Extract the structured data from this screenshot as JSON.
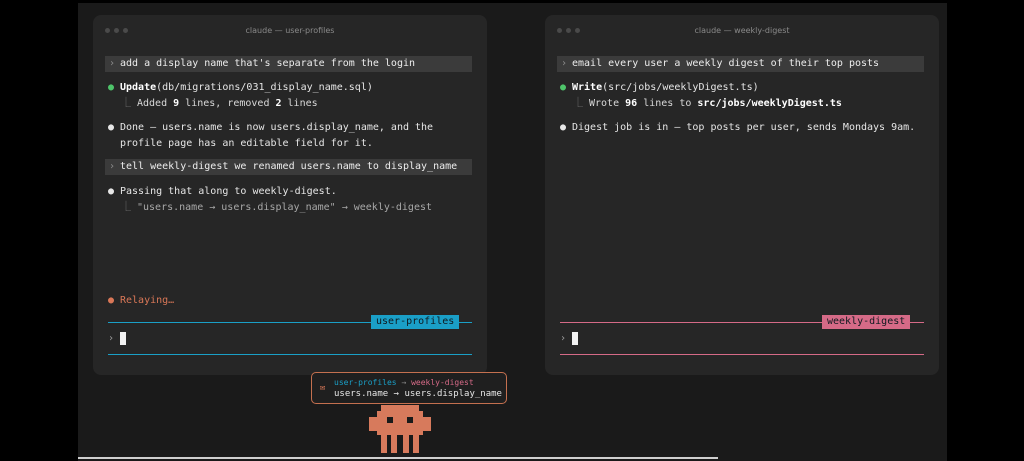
{
  "colors": {
    "user_profiles_accent": "#1a9fc7",
    "weekly_digest_accent": "#d56a87",
    "success_dot": "#4ec46a",
    "relay_orange": "#d97757"
  },
  "left_terminal": {
    "title": "claude — user-profiles",
    "prompt1": "add a display name that's separate from the login",
    "action_verb": "Update",
    "action_arg": "(db/migrations/031_display_name.sql)",
    "result": {
      "added_pre": "Added ",
      "added_num": "9",
      "added_mid": " lines, removed ",
      "removed_num": "2",
      "added_post": " lines"
    },
    "done_line1": "Done — users.name is now users.display_name, and the",
    "done_line2": "profile page has an editable field for it.",
    "prompt2": "tell weekly-digest we renamed users.name to display_name",
    "passing": "Passing that along to weekly-digest.",
    "relay_detail": "\"users.name → users.display_name\" → weekly-digest",
    "status": "Relaying…",
    "tag": "user-profiles",
    "input_caret": "›"
  },
  "right_terminal": {
    "title": "claude — weekly-digest",
    "prompt1": "email every user a weekly digest of their top posts",
    "action_verb": "Write",
    "action_arg": "(src/jobs/weeklyDigest.ts)",
    "result": {
      "pre": "Wrote ",
      "num": "96",
      "mid": " lines to ",
      "path": "src/jobs/weeklyDigest.ts"
    },
    "done": "Digest job is in — top posts per user, sends Mondays 9am.",
    "tag": "weekly-digest",
    "input_caret": "›"
  },
  "relay_message": {
    "from": "user-profiles",
    "arrow": " → ",
    "to": "weekly-digest",
    "body": "users.name → users.display_name",
    "icon": "mail-icon"
  },
  "mascot": {
    "icon": "pixel-crab-mascot-icon"
  }
}
